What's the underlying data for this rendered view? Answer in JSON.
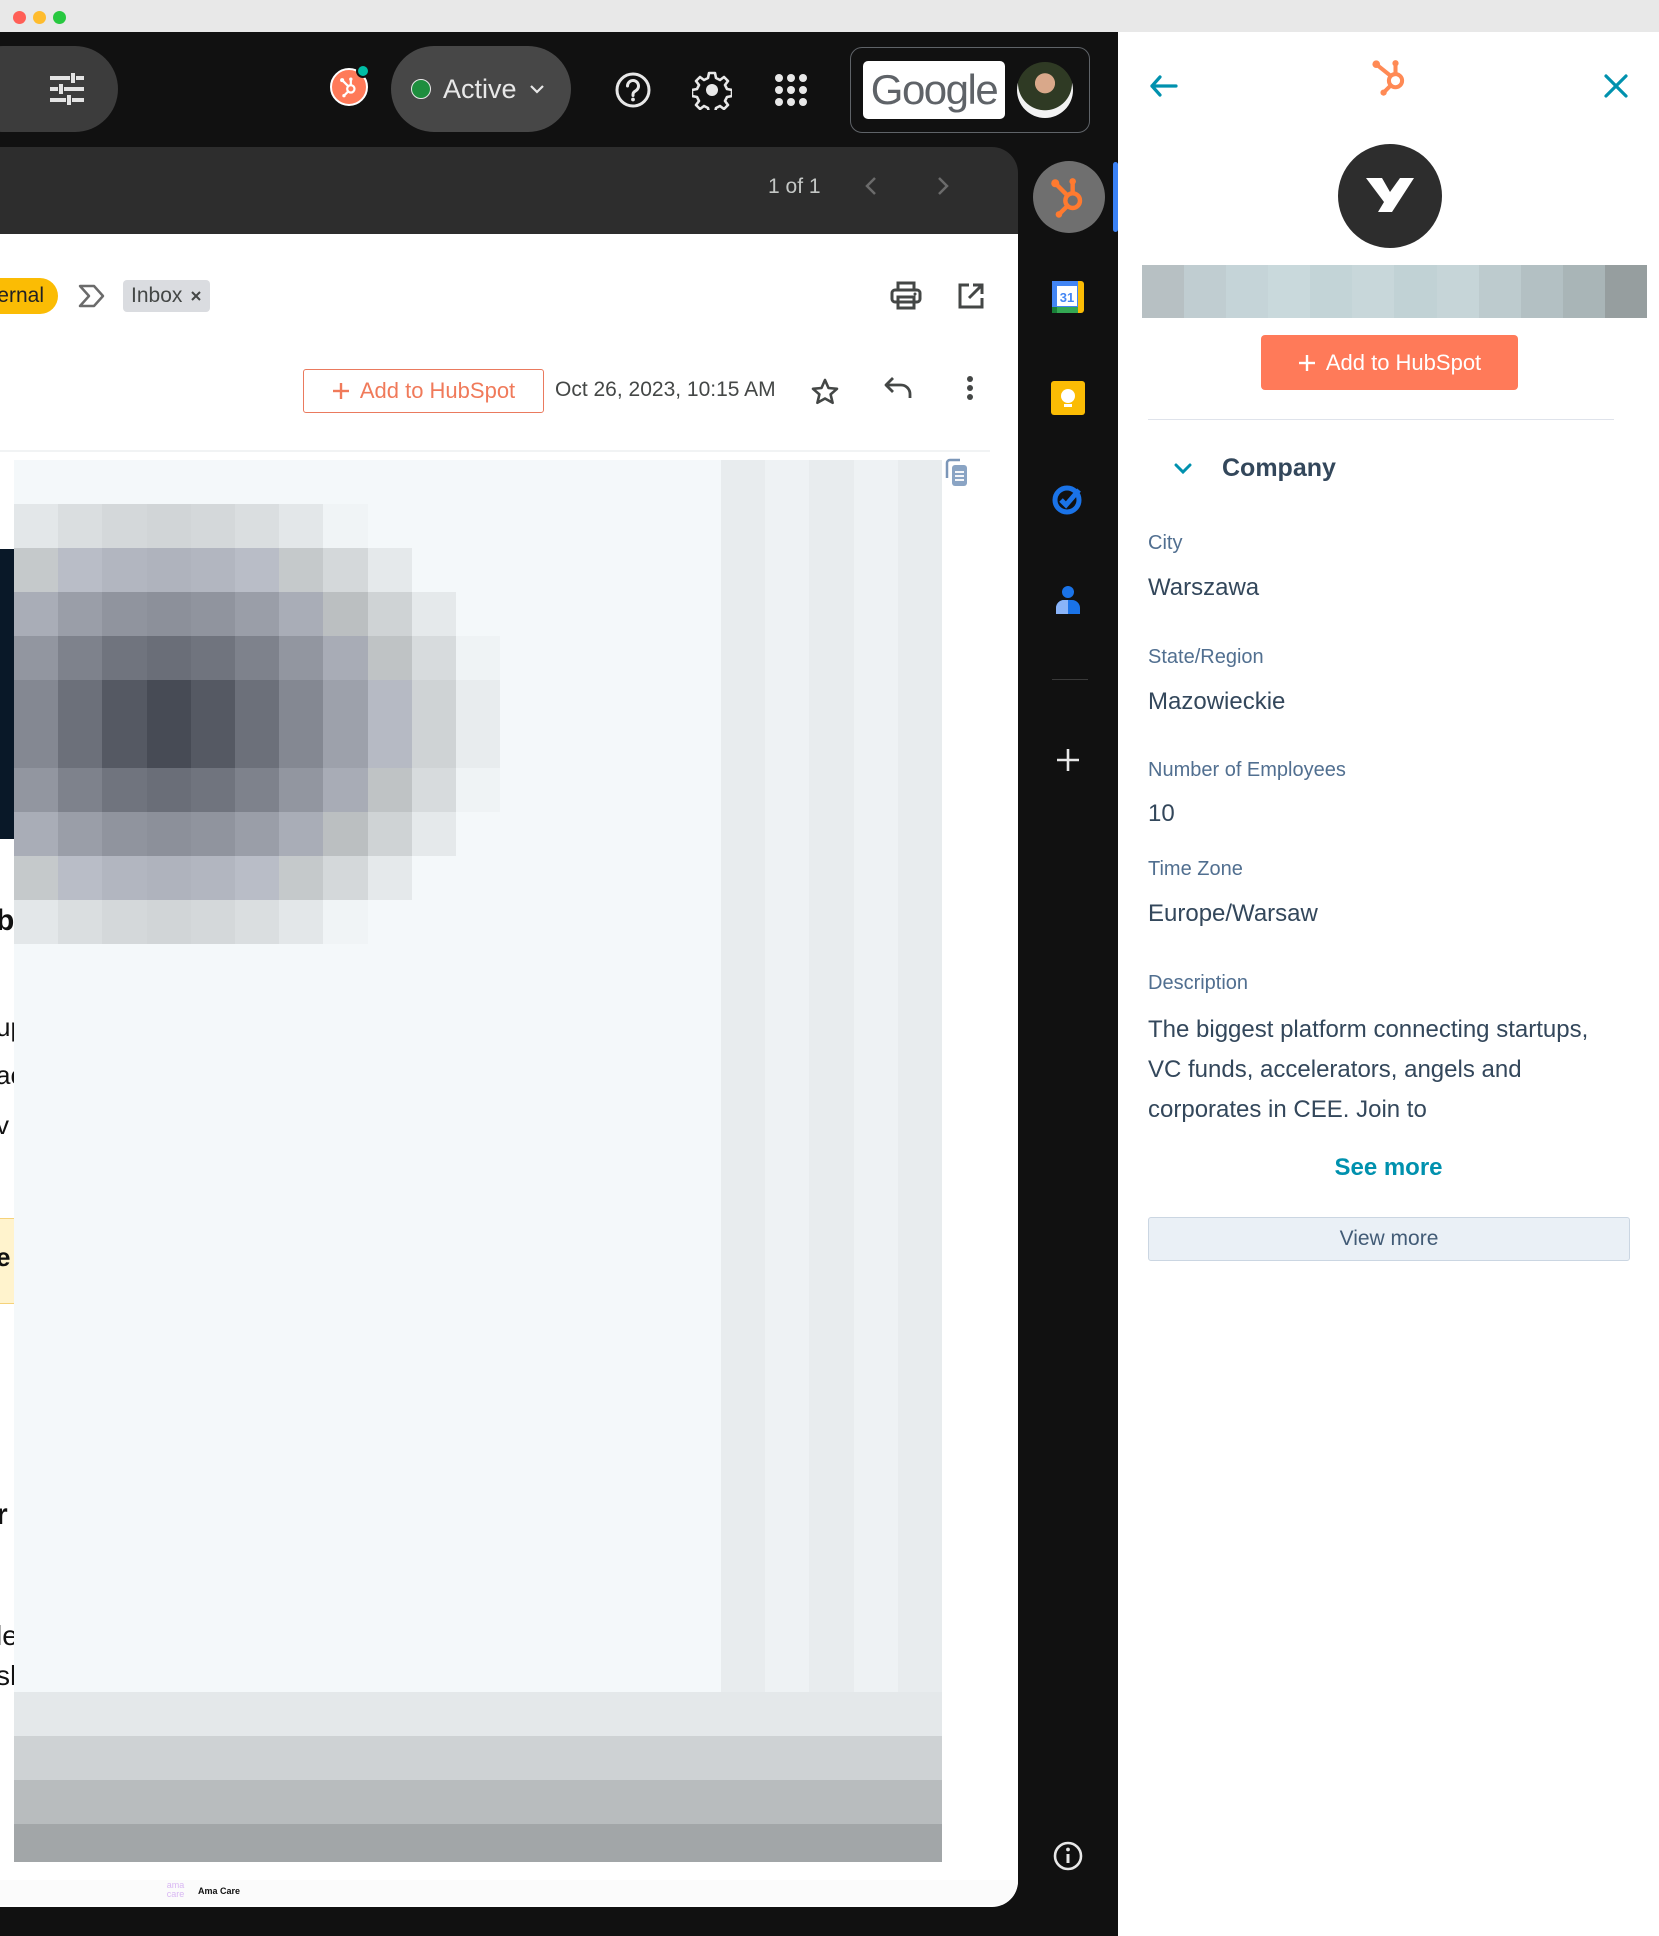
{
  "window": {
    "traffic_lights": [
      "close",
      "minimize",
      "zoom"
    ]
  },
  "topbar": {
    "filter_icon": "tune-icon",
    "hubspot_badge_icon": "hubspot-sprocket-icon",
    "status": {
      "label": "Active",
      "color": "#1e8e3e"
    },
    "help_icon": "help-circle-icon",
    "settings_icon": "gear-icon",
    "apps_icon": "apps-grid-icon",
    "account": {
      "brand": "Google"
    }
  },
  "mail_toolbar": {
    "pager": "1 of 1",
    "prev_icon": "chevron-left-icon",
    "next_icon": "chevron-right-icon"
  },
  "message": {
    "labels": [
      {
        "name": "ernal",
        "color": "#fbbc04"
      },
      {
        "name": "Inbox",
        "removable": true
      }
    ],
    "add_to_hubspot": "Add to HubSpot",
    "date": "Oct 26, 2023, 10:15 AM",
    "header_actions": [
      "print-icon",
      "open-in-new-window-icon"
    ],
    "row_actions": [
      "star-icon",
      "reply-icon",
      "more-vert-icon"
    ],
    "body_partial_glyphs": [
      "b",
      "up",
      "ac",
      "v",
      "e",
      "r",
      "le",
      "sh"
    ],
    "footer": {
      "logo_text": "ama care",
      "name": "Ama Care"
    }
  },
  "rail": {
    "apps": [
      {
        "name": "HubSpot",
        "icon": "hubspot-sprocket-icon",
        "active": true
      },
      {
        "name": "Calendar",
        "icon": "calendar-icon",
        "text": "31"
      },
      {
        "name": "Keep",
        "icon": "keep-bulb-icon"
      },
      {
        "name": "Tasks",
        "icon": "tasks-icon"
      },
      {
        "name": "Contacts",
        "icon": "contacts-icon"
      }
    ],
    "add_icon": "plus-icon",
    "info_icon": "info-icon"
  },
  "panel": {
    "back_icon": "arrow-left-icon",
    "logo_icon": "hubspot-sprocket-icon",
    "close_icon": "close-icon",
    "company_logo_letter": "Y",
    "add_button": "Add to HubSpot",
    "section": {
      "title": "Company",
      "expanded": true
    },
    "properties": [
      {
        "label": "City",
        "value": "Warszawa"
      },
      {
        "label": "State/Region",
        "value": "Mazowieckie"
      },
      {
        "label": "Number of Employees",
        "value": "10"
      },
      {
        "label": "Time Zone",
        "value": "Europe/Warsaw"
      }
    ],
    "description": {
      "label": "Description",
      "value": "The biggest platform connecting startups, VC funds, accelerators, angels and corporates in CEE. Join to"
    },
    "see_more": "See more",
    "view_more": "View more",
    "colors": {
      "accent": "#ff7a59",
      "link": "#0091ae",
      "text": "#33475b",
      "label": "#516f90"
    }
  }
}
